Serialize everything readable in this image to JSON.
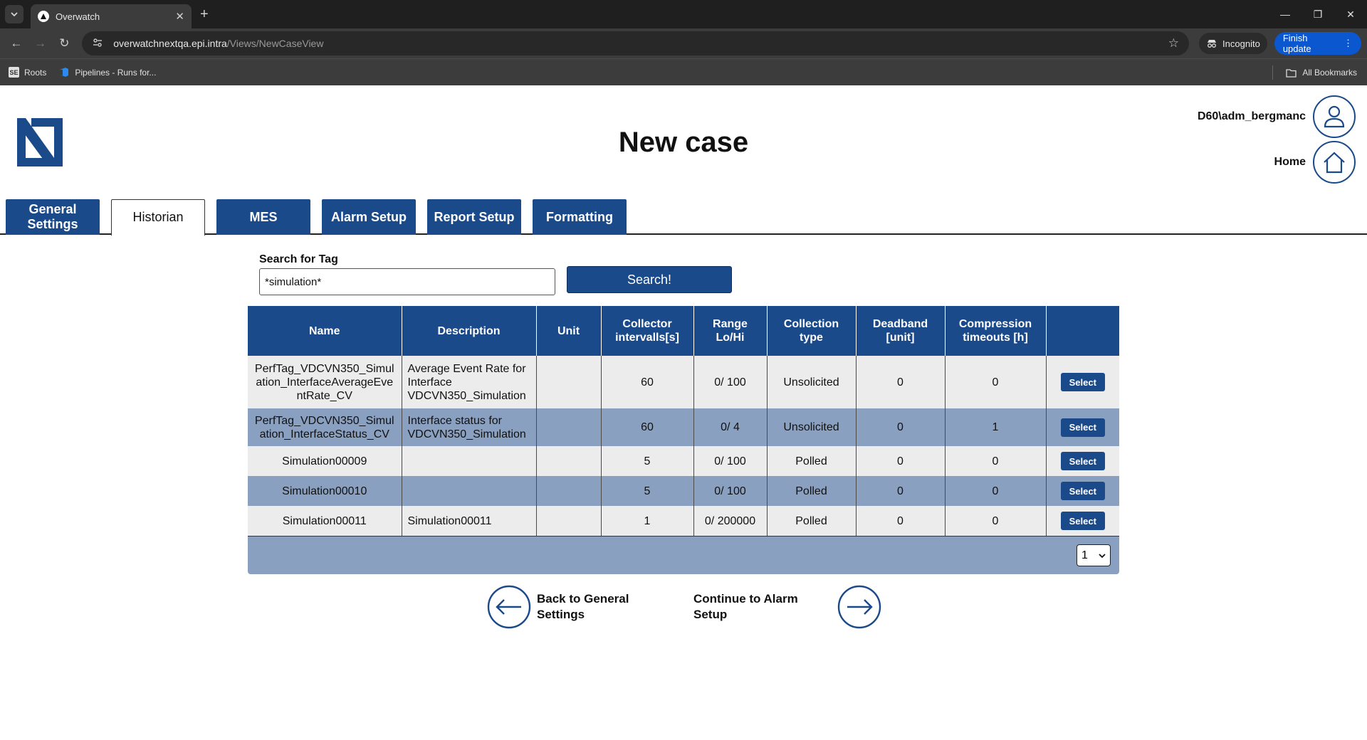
{
  "browser": {
    "tab_title": "Overwatch",
    "url_host": "overwatchnextqa.epi.intra",
    "url_path": "/Views/NewCaseView",
    "incognito_label": "Incognito",
    "finish_update_label": "Finish update",
    "bookmarks": [
      {
        "label": "Roots"
      },
      {
        "label": "Pipelines - Runs for..."
      }
    ],
    "all_bookmarks_label": "All Bookmarks"
  },
  "header": {
    "title": "New case",
    "user_name": "D60\\adm_bergmanc",
    "home_label": "Home"
  },
  "tabs": [
    {
      "label": "General Settings",
      "active": false
    },
    {
      "label": "Historian",
      "active": true
    },
    {
      "label": "MES",
      "active": false
    },
    {
      "label": "Alarm Setup",
      "active": false
    },
    {
      "label": "Report Setup",
      "active": false
    },
    {
      "label": "Formatting",
      "active": false
    }
  ],
  "search": {
    "label": "Search for Tag",
    "value": "*simulation*",
    "button_label": "Search!"
  },
  "table": {
    "columns": [
      "Name",
      "Description",
      "Unit",
      "Collector intervalls[s]",
      "Range Lo/Hi",
      "Collection type",
      "Deadband [unit]",
      "Compression timeouts [h]",
      ""
    ],
    "rows": [
      {
        "name": "PerfTag_VDCVN350_Simulation_InterfaceAverageEventRate_CV",
        "description": "Average Event Rate for Interface VDCVN350_Simulation",
        "unit": "",
        "interval": "60",
        "range": "0/ 100",
        "type": "Unsolicited",
        "deadband": "0",
        "compression": "0",
        "action": "Select"
      },
      {
        "name": "PerfTag_VDCVN350_Simulation_InterfaceStatus_CV",
        "description": "Interface status for VDCVN350_Simulation",
        "unit": "",
        "interval": "60",
        "range": "0/ 4",
        "type": "Unsolicited",
        "deadband": "0",
        "compression": "1",
        "action": "Select"
      },
      {
        "name": "Simulation00009",
        "description": "",
        "unit": "",
        "interval": "5",
        "range": "0/ 100",
        "type": "Polled",
        "deadband": "0",
        "compression": "0",
        "action": "Select"
      },
      {
        "name": "Simulation00010",
        "description": "",
        "unit": "",
        "interval": "5",
        "range": "0/ 100",
        "type": "Polled",
        "deadband": "0",
        "compression": "0",
        "action": "Select"
      },
      {
        "name": "Simulation00011",
        "description": "Simulation00011",
        "unit": "",
        "interval": "1",
        "range": "0/ 200000",
        "type": "Polled",
        "deadband": "0",
        "compression": "0",
        "action": "Select"
      }
    ],
    "page_selected": "1"
  },
  "footer_nav": {
    "back_label": "Back to General Settings",
    "next_label": "Continue to Alarm Setup"
  },
  "colors": {
    "primary": "#1b4a8a",
    "row_alt": "#8aa0c0",
    "row_base": "#ececec"
  }
}
